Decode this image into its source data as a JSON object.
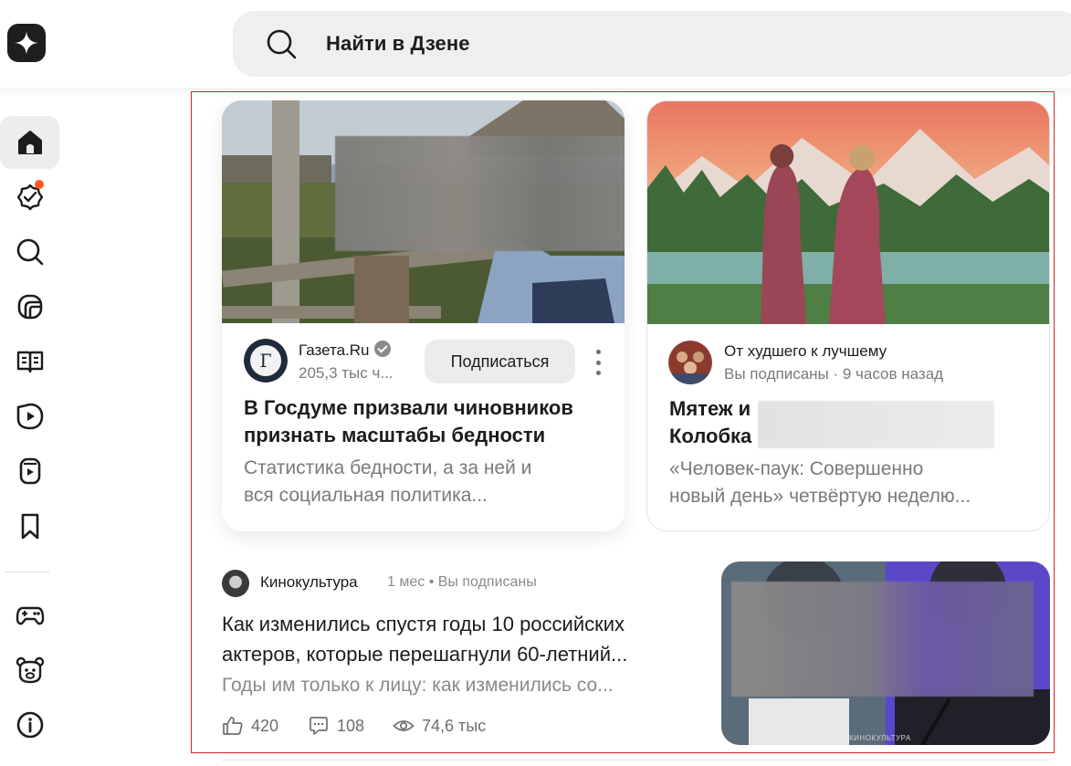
{
  "colors": {
    "accent": "#1c1c1c",
    "notify_dot": "#ff5a1f",
    "selection_frame": "#d9252b",
    "muted_text": "#7a7a7a"
  },
  "header": {
    "logo_icon": "zen-sparkle-icon",
    "search_icon": "search-icon",
    "search_placeholder": "Найти в Дзене"
  },
  "sidebar": {
    "items": [
      {
        "icon": "home-icon",
        "active": true
      },
      {
        "icon": "subscriptions-check-icon",
        "badge": true
      },
      {
        "icon": "search-icon"
      },
      {
        "icon": "shorts-icon"
      },
      {
        "icon": "articles-book-icon"
      },
      {
        "icon": "video-play-icon"
      },
      {
        "icon": "tv-play-icon"
      },
      {
        "icon": "bookmark-icon"
      },
      {
        "icon": "gamepad-icon"
      },
      {
        "icon": "kids-bear-icon"
      },
      {
        "icon": "info-icon"
      }
    ]
  },
  "feed": {
    "cards": [
      {
        "source": "Газета.Ru",
        "verified": true,
        "meta": "205,3 тыс ч...",
        "subscribe_label": "Подписаться",
        "title_line1": "В Госдуме призвали чиновников",
        "title_line2": "признать масштабы бедности",
        "snippet_line1": "Статистика бедности, а за ней и",
        "snippet_line2": "вся социальная политика..."
      },
      {
        "source": "От худшего к лучшему",
        "meta": "Вы подписаны · 9 часов назад",
        "title_line1": "Мятеж и",
        "title_line2": "Колобка",
        "snippet_line1": "«Человек-паук: Совершенно",
        "snippet_line2": "новый день» четвёртую неделю..."
      }
    ],
    "article": {
      "source": "Кинокультура",
      "meta": "1 мес • Вы подписаны",
      "title": "Как изменились спустя годы 10 российских актеров, которые перешагнули 60-летний...",
      "snippet": "Годы им только к лицу: как изменились со...",
      "likes": "420",
      "comments": "108",
      "views": "74,6 тыс",
      "watermark": "КИНОКУЛЬТУРА"
    }
  }
}
